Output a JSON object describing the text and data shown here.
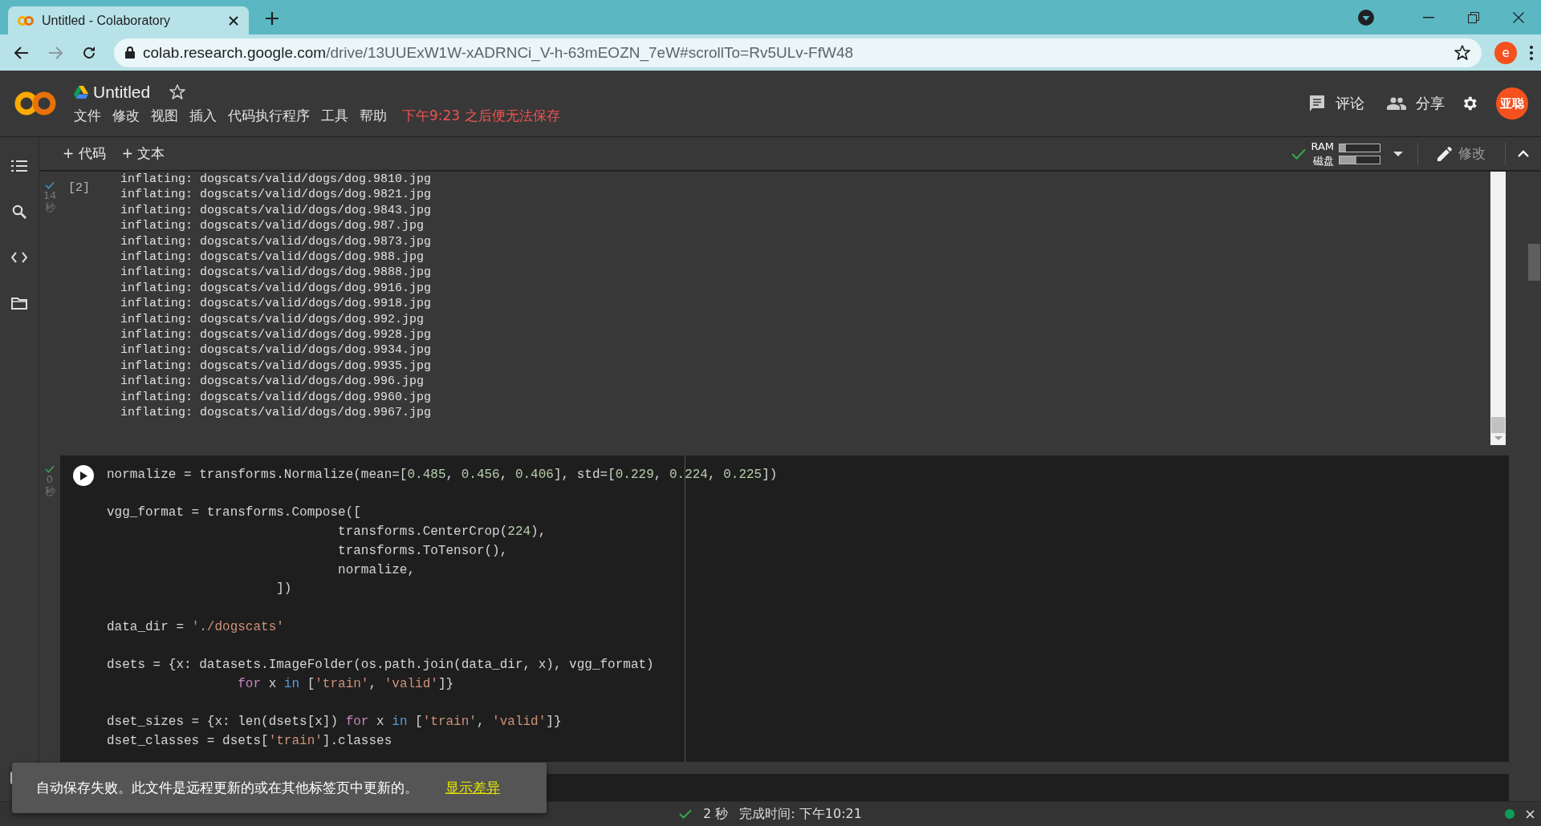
{
  "browser": {
    "tab_title": "Untitled - Colaboratory",
    "url_host": "colab.research.google.com",
    "url_path": "/drive/13UUExW1W-xADRNCi_V-h-63mEOZN_7eW#scrollTo=Rv5ULv-FfW48",
    "forward_disabled": true,
    "profile_initial": "e"
  },
  "notebook": {
    "title": "Untitled",
    "menu": [
      "文件",
      "修改",
      "视图",
      "插入",
      "代码执行程序",
      "工具",
      "帮助"
    ],
    "save_warning": "下午9:23 之后便无法保存",
    "comment_label": "评论",
    "share_label": "分享",
    "avatar": "亚聪"
  },
  "toolbar": {
    "add_buttons": [
      "+ 代码",
      "+ 文本"
    ],
    "connected": true,
    "resources": [
      {
        "label": "RAM",
        "level": 0.15
      },
      {
        "label": "磁盘",
        "level": 0.42
      }
    ],
    "edit_label": "修改",
    "edit_disabled": true
  },
  "cells": [
    {
      "kind": "output",
      "focused": false,
      "done": true,
      "time": "14",
      "unit": "秒",
      "exec_count": "[2]",
      "lines": [
        "inflating: dogscats/valid/dogs/dog.9810.jpg",
        "inflating: dogscats/valid/dogs/dog.9821.jpg",
        "inflating: dogscats/valid/dogs/dog.9843.jpg",
        "inflating: dogscats/valid/dogs/dog.987.jpg",
        "inflating: dogscats/valid/dogs/dog.9873.jpg",
        "inflating: dogscats/valid/dogs/dog.988.jpg",
        "inflating: dogscats/valid/dogs/dog.9888.jpg",
        "inflating: dogscats/valid/dogs/dog.9916.jpg",
        "inflating: dogscats/valid/dogs/dog.9918.jpg",
        "inflating: dogscats/valid/dogs/dog.992.jpg",
        "inflating: dogscats/valid/dogs/dog.9928.jpg",
        "inflating: dogscats/valid/dogs/dog.9934.jpg",
        "inflating: dogscats/valid/dogs/dog.9935.jpg",
        "inflating: dogscats/valid/dogs/dog.996.jpg",
        "inflating: dogscats/valid/dogs/dog.9960.jpg",
        "inflating: dogscats/valid/dogs/dog.9967.jpg"
      ]
    },
    {
      "kind": "code",
      "focused": true,
      "done": true,
      "time": "0",
      "unit": "秒",
      "lines": [
        {
          "kind": "code",
          "tokens": [
            {
              "text": "normalize = transforms.Normalize(mean=[",
              "kind": "plain"
            },
            {
              "text": "0.485",
              "kind": "number"
            },
            {
              "text": ", ",
              "kind": "plain"
            },
            {
              "text": "0.456",
              "kind": "number"
            },
            {
              "text": ", ",
              "kind": "plain"
            },
            {
              "text": "0.406",
              "kind": "number"
            },
            {
              "text": "], std=[",
              "kind": "plain"
            },
            {
              "text": "0.229",
              "kind": "number"
            },
            {
              "text": ", ",
              "kind": "plain"
            },
            {
              "text": "0.224",
              "kind": "number"
            },
            {
              "text": ", ",
              "kind": "plain"
            },
            {
              "text": "0.225",
              "kind": "number"
            },
            {
              "text": "])",
              "kind": "plain"
            }
          ]
        },
        {
          "kind": "blank"
        },
        {
          "kind": "code",
          "tokens": [
            {
              "text": "vgg_format = transforms.Compose([",
              "kind": "plain"
            }
          ]
        },
        {
          "kind": "code",
          "tokens": [
            {
              "text": "                              transforms.CenterCrop(",
              "kind": "plain"
            },
            {
              "text": "224",
              "kind": "number"
            },
            {
              "text": "),",
              "kind": "plain"
            }
          ]
        },
        {
          "kind": "code",
          "tokens": [
            {
              "text": "                              transforms.ToTensor(),",
              "kind": "plain"
            }
          ]
        },
        {
          "kind": "code",
          "tokens": [
            {
              "text": "                              normalize,",
              "kind": "plain"
            }
          ]
        },
        {
          "kind": "code",
          "tokens": [
            {
              "text": "                      ])",
              "kind": "plain"
            }
          ]
        },
        {
          "kind": "blank"
        },
        {
          "kind": "code",
          "tokens": [
            {
              "text": "data_dir = ",
              "kind": "plain"
            },
            {
              "text": "'./dogscats'",
              "kind": "string"
            }
          ]
        },
        {
          "kind": "blank"
        },
        {
          "kind": "code",
          "tokens": [
            {
              "text": "dsets = {x: datasets.ImageFolder(os.path.join(data_dir, x), vgg_format)",
              "kind": "plain"
            }
          ]
        },
        {
          "kind": "code",
          "tokens": [
            {
              "text": "                 for",
              "kind": "keyword"
            },
            {
              "text": " x ",
              "kind": "plain"
            },
            {
              "text": "in",
              "kind": "operator"
            },
            {
              "text": " [",
              "kind": "plain"
            },
            {
              "text": "'train'",
              "kind": "string"
            },
            {
              "text": ", ",
              "kind": "plain"
            },
            {
              "text": "'valid'",
              "kind": "string"
            },
            {
              "text": "]}",
              "kind": "plain"
            }
          ]
        },
        {
          "kind": "blank"
        },
        {
          "kind": "code",
          "tokens": [
            {
              "text": "dset_sizes = {x: len(dsets[x]) ",
              "kind": "plain"
            },
            {
              "text": "for",
              "kind": "keyword"
            },
            {
              "text": " x ",
              "kind": "plain"
            },
            {
              "text": "in",
              "kind": "operator"
            },
            {
              "text": " [",
              "kind": "plain"
            },
            {
              "text": "'train'",
              "kind": "string"
            },
            {
              "text": ", ",
              "kind": "plain"
            },
            {
              "text": "'valid'",
              "kind": "string"
            },
            {
              "text": "]}",
              "kind": "plain"
            }
          ]
        },
        {
          "kind": "code",
          "tokens": [
            {
              "text": "dset_classes = dsets[",
              "kind": "plain"
            },
            {
              "text": "'train'",
              "kind": "string"
            },
            {
              "text": "].classes",
              "kind": "plain"
            }
          ]
        }
      ]
    }
  ],
  "toast": {
    "message": "自动保存失败。此文件是远程更新的或在其他标签页中更新的。",
    "link": "显示差异"
  },
  "status_bar": {
    "done": true,
    "duration": "2 秒",
    "finished": "完成时间: 下午10:21"
  }
}
